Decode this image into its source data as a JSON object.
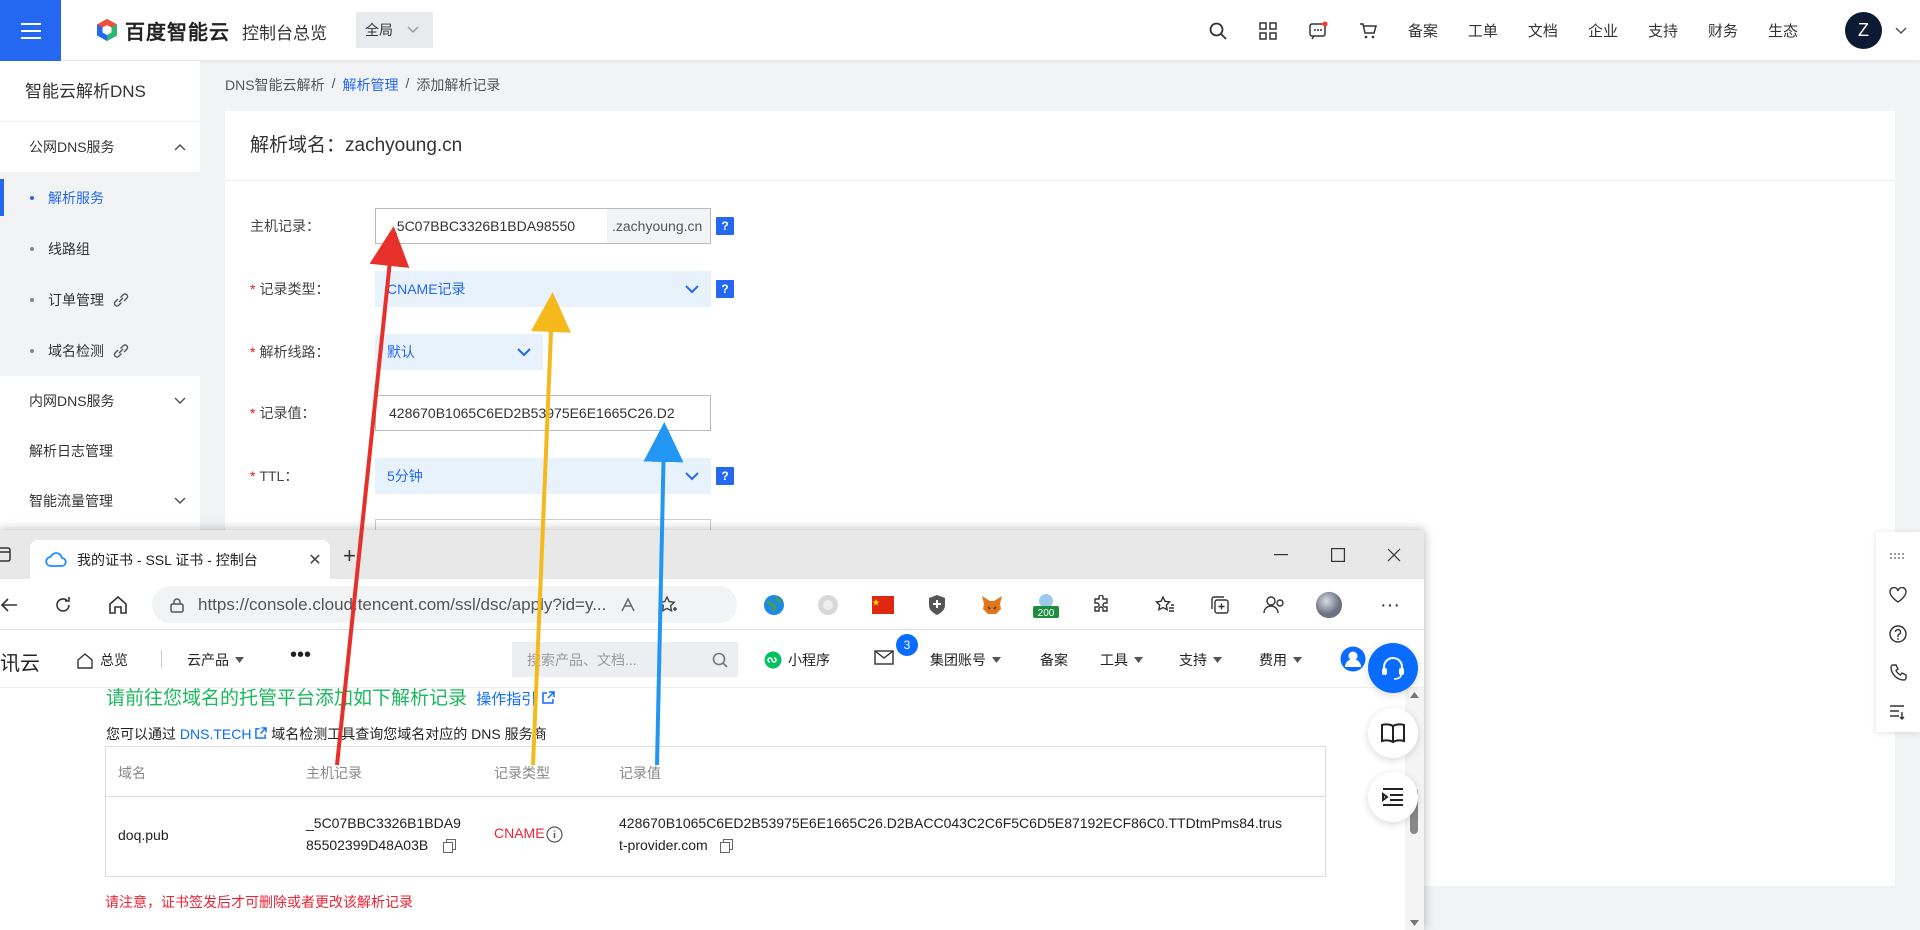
{
  "topbar": {
    "brand": "百度智能云",
    "console": "控制台总览",
    "region": "全局",
    "links": [
      "备案",
      "工单",
      "文档",
      "企业",
      "支持",
      "财务",
      "生态"
    ],
    "avatar_letter": "Z"
  },
  "sidebar": {
    "title": "智能云解析DNS",
    "public_group": "公网DNS服务",
    "items": [
      "解析服务",
      "线路组",
      "订单管理",
      "域名检测"
    ],
    "groups": [
      "内网DNS服务",
      "解析日志管理",
      "智能流量管理"
    ]
  },
  "breadcrumb": {
    "root": "DNS智能云解析",
    "mid": "解析管理",
    "current": "添加解析记录",
    "sep": "/"
  },
  "form": {
    "title": "解析域名：zachyoung.cn",
    "host_label": "主机记录：",
    "host_value": "_5C07BBC3326B1BDA98550",
    "host_suffix": ".zachyoung.cn",
    "type_label": "记录类型：",
    "type_value": "CNAME记录",
    "line_label": "解析线路：",
    "line_value": "默认",
    "value_label": "记录值：",
    "value_value": "428670B1065C6ED2B53975E6E1665C26.D2",
    "ttl_label": "TTL：",
    "ttl_value": "5分钟",
    "required_mark": "*",
    "help": "?"
  },
  "browser": {
    "tab_title": "我的证书 - SSL 证书 - 控制台",
    "url": "https://console.cloud.tencent.com/ssl/dsc/apply?id=y...",
    "brand": "讯云",
    "nav": {
      "overview": "总览",
      "products": "云产品",
      "search_placeholder": "搜索产品、文档...",
      "mini": "小程序",
      "badge": "3",
      "group": "集团账号",
      "beian": "备案",
      "tools": "工具",
      "support": "支持",
      "fee": "费用"
    },
    "ext_badge": "200",
    "hint_main": "请前往您域名的托管平台添加如下解析记录",
    "hint_link": "操作指引",
    "hint2_prefix": "您可以通过",
    "hint2_link": "DNS.TECH",
    "hint2_suffix": "域名检测工具查询您域名对应的 DNS 服务商",
    "table": {
      "headers": [
        "域名",
        "主机记录",
        "记录类型",
        "记录值"
      ],
      "row": {
        "domain": "doq.pub",
        "host_line1": "_5C07BBC3326B1BDA9",
        "host_line2": "85502399D48A03B",
        "type": "CNAME",
        "value_line1": "428670B1065C6ED2B53975E6E1665C26.D2BACC043C2C6F5C6D5E87192ECF86C0.TTDtmPms84.trus",
        "value_line2": "t-provider.com"
      }
    },
    "warning": "请注意，证书签发后才可删除或者更改该解析记录"
  },
  "colors": {
    "accent": "#2468f2",
    "tencent_blue": "#0a6cff",
    "green": "#19b95c",
    "arrow_red": "#e8302a",
    "arrow_yellow": "#f6b91c",
    "arrow_blue": "#2196f3"
  }
}
